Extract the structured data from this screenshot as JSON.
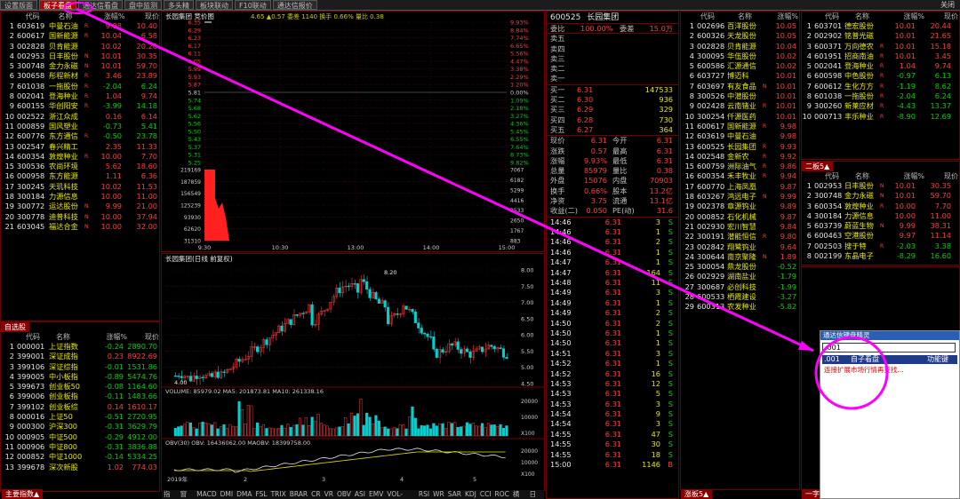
{
  "tabs": [
    "设置版面",
    "板子看盘",
    "通达信看盘",
    "盘中监测",
    "多头精",
    "板块联动",
    "F10联动",
    "通达信报价"
  ],
  "close_label": "关闭",
  "colors": {
    "up": "#ff3c3c",
    "down": "#00d200",
    "accent": "#b00000",
    "highlight": "#ff00ff"
  },
  "left_table": {
    "headers": [
      "代码",
      "名称",
      "涨幅%",
      "现价"
    ],
    "rows": [
      {
        "n": "1",
        "code": "603619",
        "name": "中曼石油",
        "flag": "R",
        "chg": "9.98",
        "price": "10.40",
        "dir": "up"
      },
      {
        "n": "2",
        "code": "600617",
        "name": "国新能源",
        "flag": "R",
        "chg": "10.04",
        "price": "6.58",
        "dir": "up"
      },
      {
        "n": "3",
        "code": "002828",
        "name": "贝肯能源",
        "flag": "",
        "chg": "10.02",
        "price": "20.20",
        "dir": "up"
      },
      {
        "n": "4",
        "code": "002953",
        "name": "日丰股份",
        "flag": "N",
        "chg": "10.01",
        "price": "30.35",
        "dir": "up"
      },
      {
        "n": "5",
        "code": "300748",
        "name": "金力永磁",
        "flag": "N",
        "chg": "10.01",
        "price": "59.70",
        "dir": "up"
      },
      {
        "n": "6",
        "code": "300658",
        "name": "彤程新材",
        "flag": "R",
        "chg": "3.46",
        "price": "23.89",
        "dir": "up"
      },
      {
        "n": "7",
        "code": "601038",
        "name": "一拖股份",
        "flag": "R",
        "chg": "-2.04",
        "price": "6.24",
        "dir": "down"
      },
      {
        "n": "8",
        "code": "002041",
        "name": "登海种业",
        "flag": "R",
        "chg": "1.04",
        "price": "9.74",
        "dir": "up"
      },
      {
        "n": "9",
        "code": "600155",
        "name": "华创阳安",
        "flag": "R",
        "chg": "-3.99",
        "price": "14.18",
        "dir": "down"
      },
      {
        "n": "10",
        "code": "002522",
        "name": "浙江众成",
        "flag": "",
        "chg": "0.16",
        "price": "6.14",
        "dir": "up"
      },
      {
        "n": "11",
        "code": "000859",
        "name": "国风塑业",
        "flag": "",
        "chg": "-0.73",
        "price": "5.41",
        "dir": "down"
      },
      {
        "n": "12",
        "code": "600776",
        "name": "东方通信",
        "flag": "R",
        "chg": "-0.50",
        "price": "23.78",
        "dir": "down"
      },
      {
        "n": "13",
        "code": "002547",
        "name": "春兴精工",
        "flag": "",
        "chg": "2.35",
        "price": "11.33",
        "dir": "up"
      },
      {
        "n": "14",
        "code": "600354",
        "name": "敦煌种业",
        "flag": "R",
        "chg": "10.00",
        "price": "7.70",
        "dir": "up"
      },
      {
        "n": "15",
        "code": "300536",
        "name": "农尚环境",
        "flag": "",
        "chg": "5.62",
        "price": "18.60",
        "dir": "up"
      },
      {
        "n": "16",
        "code": "000958",
        "name": "东方能源",
        "flag": "",
        "chg": "1.11",
        "price": "6.36",
        "dir": "up"
      },
      {
        "n": "17",
        "code": "300245",
        "name": "天玑科技",
        "flag": "",
        "chg": "10.02",
        "price": "11.53",
        "dir": "up"
      },
      {
        "n": "18",
        "code": "300184",
        "name": "力源信息",
        "flag": "",
        "chg": "10.00",
        "price": "11.00",
        "dir": "up"
      },
      {
        "n": "19",
        "code": "300772",
        "name": "运达股份",
        "flag": "N",
        "chg": "9.99",
        "price": "21.00",
        "dir": "up"
      },
      {
        "n": "20",
        "code": "300778",
        "name": "迪普科技",
        "flag": "N",
        "chg": "10.00",
        "price": "37.94",
        "dir": "up"
      },
      {
        "n": "21",
        "code": "603045",
        "name": "福达合金",
        "flag": "N",
        "chg": "10.00",
        "price": "32.00",
        "dir": "up"
      }
    ]
  },
  "index_title": "自选股",
  "index_table": {
    "headers": [
      "代码",
      "名称",
      "涨幅%",
      "现价"
    ],
    "rows": [
      {
        "n": "1",
        "code": "000001",
        "name": "上证指数",
        "chg": "-0.24",
        "price": "2890.70",
        "dir": "down"
      },
      {
        "n": "2",
        "code": "399001",
        "name": "深证成指",
        "chg": "0.23",
        "price": "8922.69",
        "dir": "up"
      },
      {
        "n": "3",
        "code": "399106",
        "name": "深证综指",
        "chg": "-0.01",
        "price": "1531.86",
        "dir": "down"
      },
      {
        "n": "4",
        "code": "399005",
        "name": "中小板指",
        "chg": "-0.89",
        "price": "5474.76",
        "dir": "down"
      },
      {
        "n": "5",
        "code": "399673",
        "name": "创业板50",
        "chg": "-0.08",
        "price": "1164.60",
        "dir": "down"
      },
      {
        "n": "6",
        "code": "399006",
        "name": "创业板指",
        "chg": "-0.11",
        "price": "1483.66",
        "dir": "down"
      },
      {
        "n": "7",
        "code": "399102",
        "name": "创业板综",
        "chg": "0.14",
        "price": "1610.17",
        "dir": "up"
      },
      {
        "n": "8",
        "code": "000016",
        "name": "上证50",
        "chg": "-0.51",
        "price": "2720.95",
        "dir": "down"
      },
      {
        "n": "9",
        "code": "000300",
        "name": "沪深300",
        "chg": "-0.31",
        "price": "3629.79",
        "dir": "down"
      },
      {
        "n": "10",
        "code": "000905",
        "name": "中证500",
        "chg": "-0.29",
        "price": "4912.00",
        "dir": "down"
      },
      {
        "n": "11",
        "code": "000906",
        "name": "中证800",
        "chg": "-0.31",
        "price": "3836.88",
        "dir": "down"
      },
      {
        "n": "12",
        "code": "000852",
        "name": "中证1000",
        "chg": "-0.14",
        "price": "5334.25",
        "dir": "down"
      },
      {
        "n": "13",
        "code": "399678",
        "name": "深次新股",
        "chg": "1.02",
        "price": "774.03",
        "dir": "up"
      }
    ]
  },
  "bottom_left_label": "主要指数▲",
  "intraday": {
    "title": "长园集团 竞价图",
    "info": "4.65 ▲0.57 委差 1140 换手 0.66% 量比 0.38",
    "left_prices": [
      "6.35",
      "6.29",
      "6.23",
      "6.17",
      "6.11",
      "6.05",
      "5.99",
      "5.93",
      "5.87",
      "5.81",
      "5.74",
      "5.68",
      "5.62",
      "5.56",
      "5.50",
      "5.43",
      "5.37",
      "5.31",
      "5.25"
    ],
    "right_pcts": [
      "9.93%",
      "8.84%",
      "7.74%",
      "6.65%",
      "5.56%",
      "4.47%",
      "3.38%",
      "2.29%",
      "1.20%",
      "0.00%",
      "1.09%",
      "2.18%",
      "3.27%",
      "4.36%",
      "5.45%",
      "6.55%",
      "7.64%",
      "8.73%",
      "9.82%"
    ],
    "vol_ticks": [
      "219169",
      "187859",
      "156549",
      "125239",
      "93930",
      "62620",
      "31310"
    ],
    "right_vol_ticks": [
      "7067",
      "6182",
      "5299",
      "4416",
      "3533",
      "2650",
      "1767",
      "883"
    ],
    "time_ticks": [
      "9:30",
      "10:30",
      "13:00",
      "14:00",
      "15:00"
    ]
  },
  "kline": {
    "title": "长园集团(日线 前复权)",
    "price_ticks": [
      "8.00",
      "7.50",
      "7.00",
      "6.50",
      "6.00",
      "5.50",
      "5.00",
      "4.50"
    ],
    "high_label": "8.20",
    "low_label": "4.00",
    "vol_legend": "VOLUME: 85979.02  MA5: 201873.81  MA10: 261338.16",
    "vol_ticks": [
      "20000",
      "10000",
      "X100"
    ],
    "obv_legend": "OBV(30)  OBV: 16436062.00  MAOBV: 18399758.00",
    "obv_ticks": [
      "20000",
      "10000",
      "X100"
    ],
    "month_ticks": [
      "2019年",
      "2",
      "3",
      "4",
      "5"
    ],
    "indicators": [
      "指标",
      "窗口",
      "MACD",
      "DMI",
      "DMA",
      "FSL",
      "TRIX",
      "BRAR",
      "CR",
      "VR",
      "OBV",
      "ASI",
      "EMV",
      "VOL-TDX",
      "RSI",
      "WR",
      "SAR",
      "KDJ",
      "CCI",
      "ROC",
      "横断",
      "日线"
    ]
  },
  "quote": {
    "code": "600525",
    "name": "长园集团",
    "wb_label": "委比",
    "wb": "100.00%",
    "wc_label": "委差",
    "wc": "15.0万",
    "asks": [
      {
        "label": "卖五",
        "price": "",
        "vol": ""
      },
      {
        "label": "卖四",
        "price": "",
        "vol": ""
      },
      {
        "label": "卖三",
        "price": "",
        "vol": ""
      },
      {
        "label": "卖二",
        "price": "",
        "vol": ""
      },
      {
        "label": "卖一",
        "price": "",
        "vol": ""
      }
    ],
    "bids": [
      {
        "label": "买一",
        "price": "6.31",
        "vol": "147533"
      },
      {
        "label": "买二",
        "price": "6.30",
        "vol": "936"
      },
      {
        "label": "买三",
        "price": "6.29",
        "vol": "329"
      },
      {
        "label": "买四",
        "price": "6.28",
        "vol": "730"
      },
      {
        "label": "买五",
        "price": "6.27",
        "vol": "364"
      }
    ],
    "stats": [
      [
        "现价",
        "6.31",
        "今开",
        "6.31"
      ],
      [
        "涨跌",
        "0.57",
        "最高",
        "6.31"
      ],
      [
        "涨幅",
        "9.93%",
        "最低",
        "6.31"
      ],
      [
        "总量",
        "85979",
        "量比",
        "0.38"
      ],
      [
        "外盘",
        "15076",
        "内盘",
        "70903"
      ],
      [
        "换手",
        "0.66%",
        "股本",
        "13.2亿"
      ],
      [
        "净资",
        "3.75",
        "流通",
        "13.1亿"
      ],
      [
        "收益(二)",
        "0.050",
        "PE(动)",
        "31.6"
      ]
    ],
    "ticks": [
      [
        "14:46",
        "6.31",
        "3",
        "S"
      ],
      [
        "14:46",
        "6.31",
        "1",
        "S"
      ],
      [
        "14:46",
        "6.31",
        "2",
        "S"
      ],
      [
        "14:46",
        "6.31",
        "1",
        "S"
      ],
      [
        "14:47",
        "6.31",
        "1",
        "S"
      ],
      [
        "14:47",
        "6.31",
        "164",
        "S"
      ],
      [
        "14:48",
        "6.31",
        "11",
        "S"
      ],
      [
        "14:49",
        "6.31",
        "3",
        "S"
      ],
      [
        "14:49",
        "6.31",
        "1",
        "S"
      ],
      [
        "14:49",
        "6.31",
        "2",
        "S"
      ],
      [
        "14:50",
        "6.31",
        "2",
        "S"
      ],
      [
        "14:50",
        "6.31",
        "1",
        "S"
      ],
      [
        "14:50",
        "6.31",
        "1",
        "S"
      ],
      [
        "14:51",
        "6.31",
        "3",
        "S"
      ],
      [
        "14:52",
        "6.31",
        "1",
        "S"
      ],
      [
        "14:52",
        "6.31",
        "16",
        "S"
      ],
      [
        "14:53",
        "6.31",
        "12",
        "S"
      ],
      [
        "14:53",
        "6.31",
        "5",
        "S"
      ],
      [
        "14:53",
        "6.31",
        "3",
        "S"
      ],
      [
        "14:54",
        "6.31",
        "9",
        "S"
      ],
      [
        "14:54",
        "6.31",
        "3",
        "S"
      ],
      [
        "14:55",
        "6.31",
        "47",
        "S"
      ],
      [
        "14:55",
        "6.31",
        "30",
        "S"
      ],
      [
        "14:55",
        "6.31",
        "18",
        "S"
      ],
      [
        "15:00",
        "6.31",
        "1146",
        "B"
      ]
    ]
  },
  "mid_table": {
    "headers": [
      "代码",
      "名称",
      "涨幅%"
    ],
    "rows": [
      {
        "n": "1",
        "code": "002696",
        "name": "百洋股份",
        "flag": "",
        "chg": "10.05",
        "dir": "up"
      },
      {
        "n": "2",
        "code": "600326",
        "name": "天龙股份",
        "flag": "",
        "chg": "10.05",
        "dir": "up"
      },
      {
        "n": "3",
        "code": "002828",
        "name": "贝肯能源",
        "flag": "",
        "chg": "10.04",
        "dir": "up"
      },
      {
        "n": "4",
        "code": "300095",
        "name": "华伍股份",
        "flag": "",
        "chg": "10.02",
        "dir": "up"
      },
      {
        "n": "5",
        "code": "600586",
        "name": "汇源通信",
        "flag": "",
        "chg": "10.02",
        "dir": "up"
      },
      {
        "n": "6",
        "code": "603727",
        "name": "博迈科",
        "flag": "",
        "chg": "10.01",
        "dir": "up"
      },
      {
        "n": "7",
        "code": "603697",
        "name": "有友食品",
        "flag": "N",
        "chg": "10.01",
        "dir": "up"
      },
      {
        "n": "8",
        "code": "300526",
        "name": "中潜股份",
        "flag": "",
        "chg": "10.01",
        "dir": "up"
      },
      {
        "n": "9",
        "code": "002428",
        "name": "云南锗业",
        "flag": "R",
        "chg": "10.01",
        "dir": "up"
      },
      {
        "n": "10",
        "code": "300254",
        "name": "仟源医药",
        "flag": "",
        "chg": "10.01",
        "dir": "up"
      },
      {
        "n": "11",
        "code": "600617",
        "name": "国新能源",
        "flag": "R",
        "chg": "9.98",
        "dir": "up"
      },
      {
        "n": "12",
        "code": "603619",
        "name": "中曼石油",
        "flag": "",
        "chg": "9.98",
        "dir": "up"
      },
      {
        "n": "13",
        "code": "600525",
        "name": "长园集团",
        "flag": "R",
        "chg": "9.93",
        "dir": "up"
      },
      {
        "n": "14",
        "code": "002548",
        "name": "金新农",
        "flag": "R",
        "chg": "9.92",
        "dir": "up"
      },
      {
        "n": "15",
        "code": "600759",
        "name": "洲际油气",
        "flag": "R",
        "chg": "9.86",
        "dir": "up"
      },
      {
        "n": "16",
        "code": "600354",
        "name": "禾丰牧业",
        "flag": "R",
        "chg": "9.94",
        "dir": "up"
      },
      {
        "n": "17",
        "code": "600770",
        "name": "上海凤凰",
        "flag": "",
        "chg": "9.87",
        "dir": "up"
      },
      {
        "n": "18",
        "code": "603267",
        "name": "鸿远电子",
        "flag": "N",
        "chg": "9.99",
        "dir": "up"
      },
      {
        "n": "19",
        "code": "002378",
        "name": "章源钨业",
        "flag": "",
        "chg": "9.89",
        "dir": "up"
      },
      {
        "n": "20",
        "code": "000852",
        "name": "石化机械",
        "flag": "",
        "chg": "9.87",
        "dir": "up"
      },
      {
        "n": "21",
        "code": "002930",
        "name": "宏川智慧",
        "flag": "",
        "chg": "9.84",
        "dir": "up"
      },
      {
        "n": "22",
        "code": "300191",
        "name": "潜能恒信",
        "flag": "R",
        "chg": "9.80",
        "dir": "up"
      },
      {
        "n": "23",
        "code": "002842",
        "name": "翔鹭钨业",
        "flag": "",
        "chg": "9.64",
        "dir": "up"
      },
      {
        "n": "24",
        "code": "300644",
        "name": "南京聚隆",
        "flag": "N",
        "chg": "1.89",
        "dir": "up"
      },
      {
        "n": "25",
        "code": "300054",
        "name": "鼎龙股份",
        "flag": "",
        "chg": "-0.52",
        "dir": "down"
      },
      {
        "n": "26",
        "code": "002929",
        "name": "湖南盐业",
        "flag": "",
        "chg": "-1.79",
        "dir": "down"
      },
      {
        "n": "27",
        "code": "300687",
        "name": "必创科技",
        "flag": "",
        "chg": "-1.99",
        "dir": "down"
      },
      {
        "n": "28",
        "code": "600533",
        "name": "栖霞建设",
        "flag": "",
        "chg": "-3.27",
        "dir": "down"
      },
      {
        "n": "29",
        "code": "600313",
        "name": "农发种业",
        "flag": "",
        "chg": "-5.82",
        "dir": "down"
      }
    ]
  },
  "mid_bottom_label": "涨板5▲",
  "right_top_table": {
    "headers": [
      "代码",
      "名称",
      "涨幅%",
      "现价"
    ],
    "rows": [
      {
        "n": "1",
        "code": "603701",
        "name": "德宏股份",
        "flag": "",
        "chg": "10.01",
        "price": "20.44",
        "dir": "up"
      },
      {
        "n": "2",
        "code": "002902",
        "name": "铭普光磁",
        "flag": "",
        "chg": "10.01",
        "price": "21.65",
        "dir": "up"
      },
      {
        "n": "3",
        "code": "600371",
        "name": "万向德农",
        "flag": "R",
        "chg": "10.01",
        "price": "15.18",
        "dir": "up"
      },
      {
        "n": "4",
        "code": "601951",
        "name": "招商南油",
        "flag": "R",
        "chg": "10.01",
        "price": "3.45",
        "dir": "up"
      },
      {
        "n": "5",
        "code": "002041",
        "name": "登海种业",
        "flag": "R",
        "chg": "1.04",
        "price": "9.74",
        "dir": "up"
      },
      {
        "n": "6",
        "code": "600598",
        "name": "中色股份",
        "flag": "R",
        "chg": "-0.97",
        "price": "6.13",
        "dir": "down"
      },
      {
        "n": "7",
        "code": "600612",
        "name": "生化方方",
        "flag": "R",
        "chg": "-1.19",
        "price": "8.62",
        "dir": "down"
      },
      {
        "n": "8",
        "code": "601038",
        "name": "一拖股份",
        "flag": "R",
        "chg": "-2.04",
        "price": "6.24",
        "dir": "down"
      },
      {
        "n": "9",
        "code": "300260",
        "name": "新莱应材",
        "flag": "R",
        "chg": "-4.43",
        "price": "13.37",
        "dir": "down"
      },
      {
        "n": "10",
        "code": "000713",
        "name": "丰乐种业",
        "flag": "R",
        "chg": "-8.90",
        "price": "12.69",
        "dir": "down"
      }
    ]
  },
  "right_mid_title": "二板5▲",
  "right_mid_table": {
    "headers": [
      "代码",
      "名称",
      "涨幅%",
      "现价"
    ],
    "rows": [
      {
        "n": "1",
        "code": "002953",
        "name": "日丰股份",
        "flag": "N",
        "chg": "10.01",
        "price": "30.35",
        "dir": "up"
      },
      {
        "n": "2",
        "code": "300748",
        "name": "金力永磁",
        "flag": "N",
        "chg": "10.01",
        "price": "59.70",
        "dir": "up"
      },
      {
        "n": "3",
        "code": "600354",
        "name": "敦煌种业",
        "flag": "R",
        "chg": "10.00",
        "price": "7.70",
        "dir": "up"
      },
      {
        "n": "4",
        "code": "300184",
        "name": "力源信息",
        "flag": "",
        "chg": "10.00",
        "price": "11.00",
        "dir": "up"
      },
      {
        "n": "5",
        "code": "603739",
        "name": "蔚蓝生物",
        "flag": "N",
        "chg": "9.99",
        "price": "38.31",
        "dir": "up"
      },
      {
        "n": "6",
        "code": "600463",
        "name": "空港股份",
        "flag": "",
        "chg": "9.97",
        "price": "11.14",
        "dir": "up"
      },
      {
        "n": "7",
        "code": "002503",
        "name": "搜于特",
        "flag": "R",
        "chg": "-2.03",
        "price": "3.38",
        "dir": "down"
      },
      {
        "n": "8",
        "code": "002199",
        "name": "东晶电子",
        "flag": "",
        "chg": "-8.29",
        "price": "16.60",
        "dir": "down"
      }
    ]
  },
  "popup": {
    "title": "通达信键盘精灵",
    "input": ".001",
    "result_code": ".001",
    "result_name": "自子看盘",
    "result_type": "功能键",
    "hint": "连接扩展市场行情再查找..."
  },
  "bottom_right_label": "一字板"
}
